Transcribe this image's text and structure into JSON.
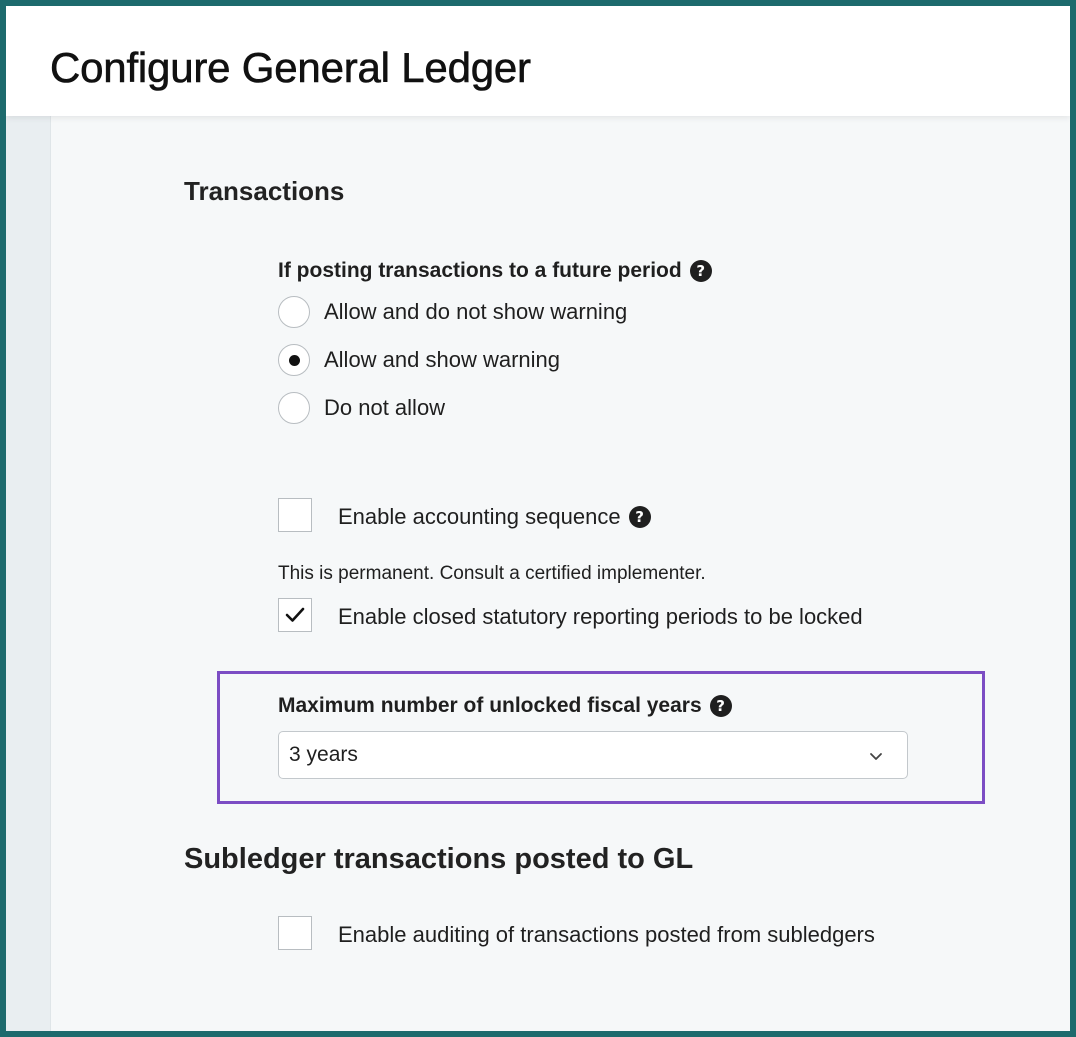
{
  "header": {
    "title": "Configure General Ledger"
  },
  "transactions": {
    "section_title": "Transactions",
    "future_period": {
      "label": "If posting transactions to a future period",
      "options": [
        {
          "label": "Allow and do not show warning",
          "selected": false
        },
        {
          "label": "Allow and show warning",
          "selected": true
        },
        {
          "label": "Do not allow",
          "selected": false
        }
      ]
    },
    "accounting_sequence": {
      "label": "Enable accounting sequence",
      "checked": false,
      "note": "This is permanent. Consult a certified implementer."
    },
    "closed_periods": {
      "label": "Enable closed statutory reporting periods to be locked",
      "checked": true
    },
    "unlocked_years": {
      "label": "Maximum number of unlocked fiscal years",
      "selected_value": "3 years"
    }
  },
  "subledger": {
    "section_title": "Subledger transactions posted to GL",
    "auditing": {
      "label": "Enable auditing of transactions posted from subledgers",
      "checked": false
    }
  },
  "colors": {
    "frame_border": "#1d6a6d",
    "highlight_border": "#7c4dc4",
    "background": "#f6f8f9"
  }
}
